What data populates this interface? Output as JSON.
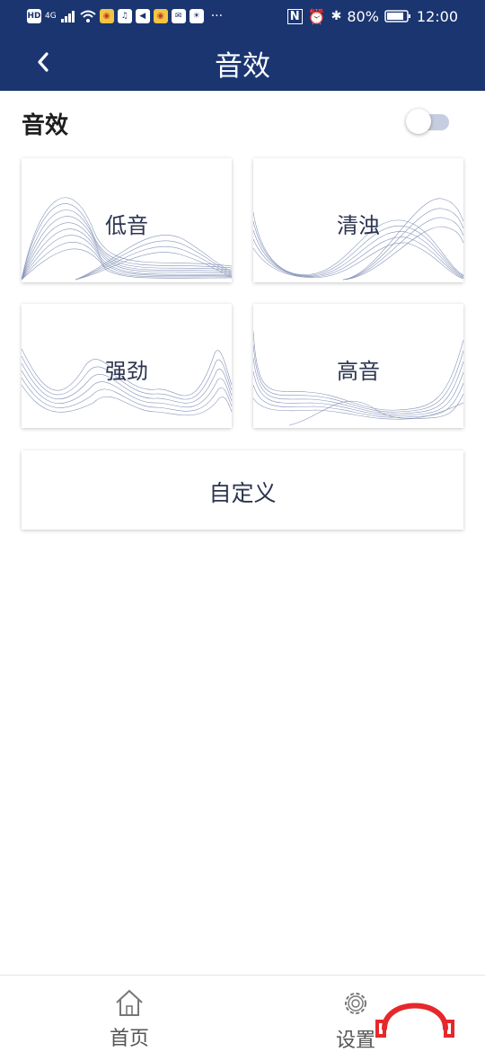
{
  "status_bar": {
    "left_icons": [
      "HD",
      "4G",
      "signal-icon",
      "wifi-icon",
      "weibo-icon",
      "app-icon",
      "app-icon",
      "weibo-icon",
      "app-icon"
    ],
    "hd": "HD",
    "network": "4G",
    "more": "···",
    "battery_percent": "80%",
    "time": "12:00"
  },
  "app_bar": {
    "title": "音效",
    "back_icon": "chevron-left-icon"
  },
  "sound_effect": {
    "label": "音效",
    "enabled": false
  },
  "presets": [
    {
      "label": "低音"
    },
    {
      "label": "清浊"
    },
    {
      "label": "强劲"
    },
    {
      "label": "高音"
    }
  ],
  "custom": {
    "label": "自定义"
  },
  "bottom_nav": [
    {
      "label": "首页",
      "icon": "home-icon"
    },
    {
      "label": "设置",
      "icon": "gear-icon"
    }
  ],
  "colors": {
    "primary": "#1a3570",
    "wave": "#7080aa",
    "toggle_track": "#c7cde0",
    "logo": "#e4282c"
  }
}
